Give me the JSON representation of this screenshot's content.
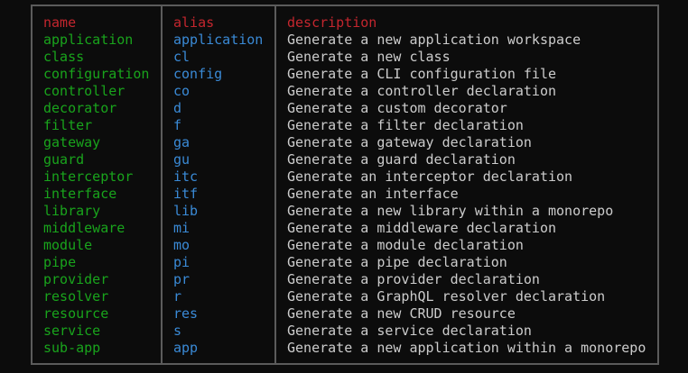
{
  "headers": {
    "name": "name",
    "alias": "alias",
    "description": "description"
  },
  "rows": [
    {
      "name": "application",
      "alias": "application",
      "description": "Generate a new application workspace"
    },
    {
      "name": "class",
      "alias": "cl",
      "description": "Generate a new class"
    },
    {
      "name": "configuration",
      "alias": "config",
      "description": "Generate a CLI configuration file"
    },
    {
      "name": "controller",
      "alias": "co",
      "description": "Generate a controller declaration"
    },
    {
      "name": "decorator",
      "alias": "d",
      "description": "Generate a custom decorator"
    },
    {
      "name": "filter",
      "alias": "f",
      "description": "Generate a filter declaration"
    },
    {
      "name": "gateway",
      "alias": "ga",
      "description": "Generate a gateway declaration"
    },
    {
      "name": "guard",
      "alias": "gu",
      "description": "Generate a guard declaration"
    },
    {
      "name": "interceptor",
      "alias": "itc",
      "description": "Generate an interceptor declaration"
    },
    {
      "name": "interface",
      "alias": "itf",
      "description": "Generate an interface"
    },
    {
      "name": "library",
      "alias": "lib",
      "description": "Generate a new library within a monorepo"
    },
    {
      "name": "middleware",
      "alias": "mi",
      "description": "Generate a middleware declaration"
    },
    {
      "name": "module",
      "alias": "mo",
      "description": "Generate a module declaration"
    },
    {
      "name": "pipe",
      "alias": "pi",
      "description": "Generate a pipe declaration"
    },
    {
      "name": "provider",
      "alias": "pr",
      "description": "Generate a provider declaration"
    },
    {
      "name": "resolver",
      "alias": "r",
      "description": "Generate a GraphQL resolver declaration"
    },
    {
      "name": "resource",
      "alias": "res",
      "description": "Generate a new CRUD resource"
    },
    {
      "name": "service",
      "alias": "s",
      "description": "Generate a service declaration"
    },
    {
      "name": "sub-app",
      "alias": "app",
      "description": "Generate a new application within a monorepo"
    }
  ],
  "colors": {
    "background": "#0c0c0c",
    "border": "#5b5b5b",
    "header": "#c4262e",
    "name": "#19a41c",
    "alias": "#3a8ad6",
    "description": "#cccccc"
  }
}
